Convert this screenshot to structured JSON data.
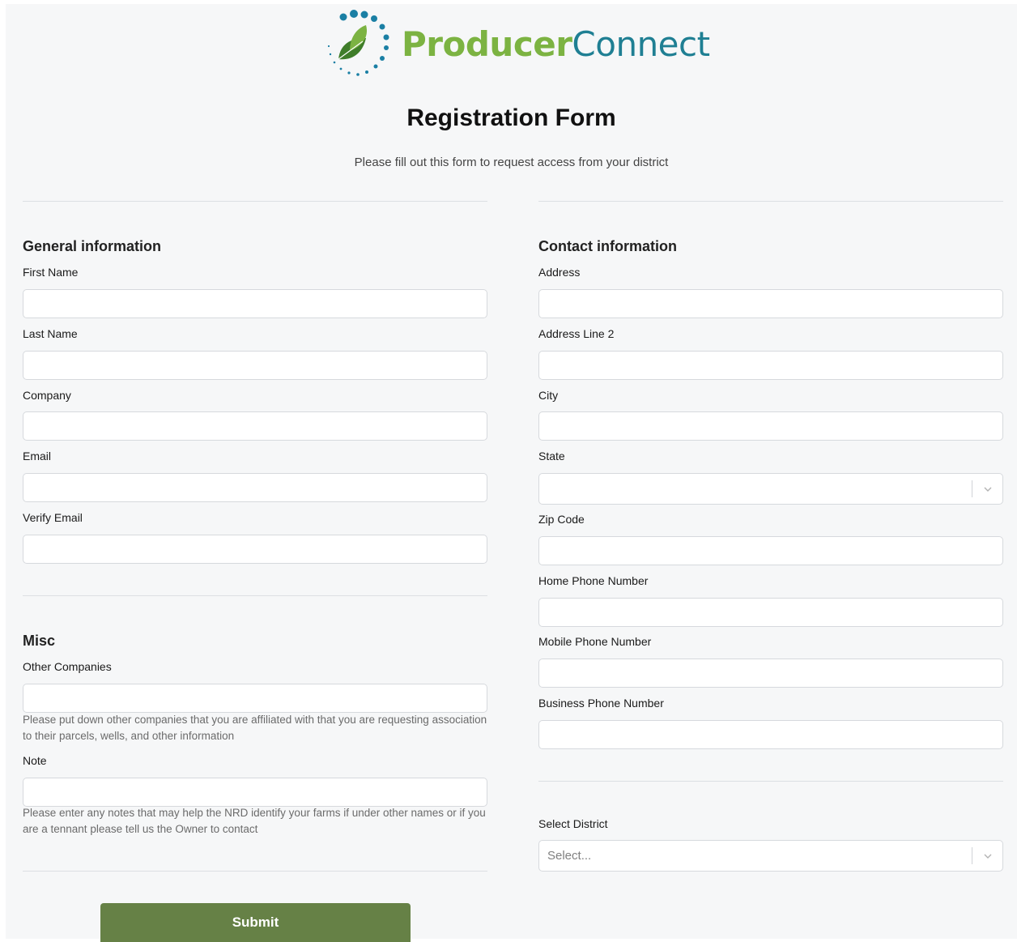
{
  "brand": {
    "name_part1": "Producer",
    "name_part2": "Connect",
    "colors": {
      "green": "#7cb342",
      "teal": "#1f7f93",
      "dots": "#1a7fa4"
    }
  },
  "header": {
    "title": "Registration Form",
    "subtitle": "Please fill out this form to request access from your district"
  },
  "general": {
    "section_title": "General information",
    "first_name_label": "First Name",
    "first_name_value": "",
    "last_name_label": "Last Name",
    "last_name_value": "",
    "company_label": "Company",
    "company_value": "",
    "email_label": "Email",
    "email_value": "",
    "verify_email_label": "Verify Email",
    "verify_email_value": ""
  },
  "misc": {
    "section_title": "Misc",
    "other_companies_label": "Other Companies",
    "other_companies_value": "",
    "other_companies_help": "Please put down other companies that you are affiliated with that you are requesting association to their parcels, wells, and other information",
    "note_label": "Note",
    "note_value": "",
    "note_help": "Please enter any notes that may help the NRD identify your farms if under other names or if you are a tennant please tell us the Owner to contact"
  },
  "contact": {
    "section_title": "Contact information",
    "address_label": "Address",
    "address_value": "",
    "address2_label": "Address Line 2",
    "address2_value": "",
    "city_label": "City",
    "city_value": "",
    "state_label": "State",
    "state_value": "",
    "zip_label": "Zip Code",
    "zip_value": "",
    "home_phone_label": "Home Phone Number",
    "home_phone_value": "",
    "mobile_phone_label": "Mobile Phone Number",
    "mobile_phone_value": "",
    "business_phone_label": "Business Phone Number",
    "business_phone_value": ""
  },
  "district": {
    "label": "Select District",
    "placeholder": "Select..."
  },
  "actions": {
    "submit_label": "Submit",
    "submit_color": "#668146"
  },
  "icons": {
    "logo": "producerconnect-leaf-logo-icon",
    "select_arrow": "chevron-down-icon"
  }
}
